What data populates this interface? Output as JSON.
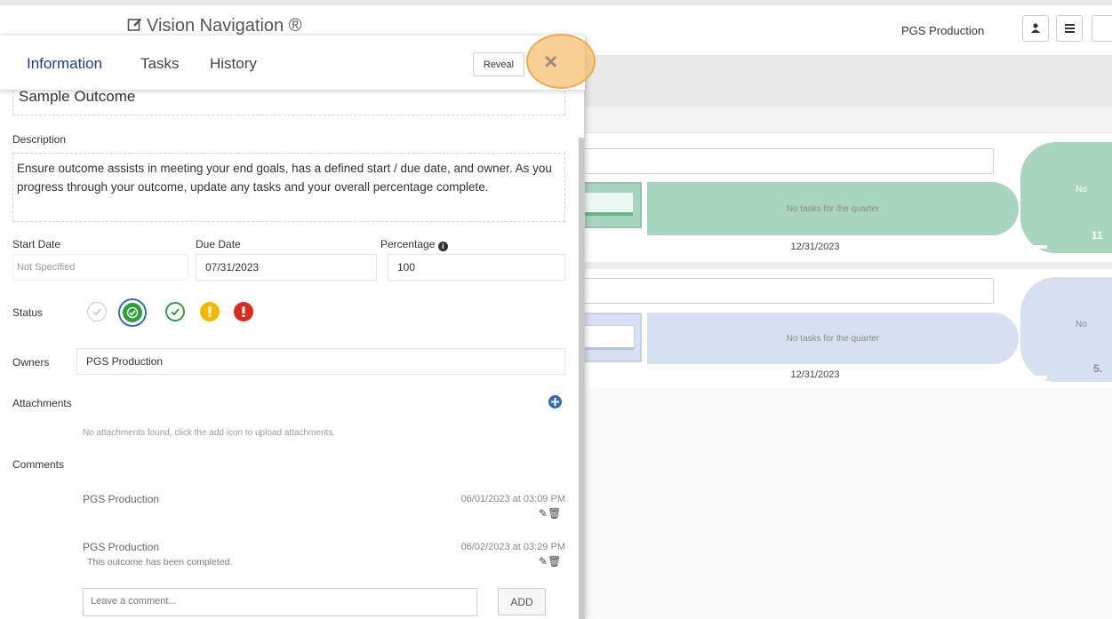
{
  "header": {
    "app_title": "Vision Navigation ®",
    "user_name": "PGS Production",
    "user_icon": "user-icon",
    "menu_icon": "hamburger-icon"
  },
  "board": {
    "rows": [
      {
        "pill_text": "No tasks for the quarter",
        "date": "12/31/2023",
        "right_text": "No",
        "right_value": "11",
        "color": "#a8d5bf"
      },
      {
        "pill_text": "No tasks for the quarter",
        "date": "12/31/2023",
        "right_text": "No",
        "right_value": "5.",
        "color": "#d6e0f0"
      }
    ]
  },
  "panel": {
    "tabs": [
      "Information",
      "Tasks",
      "History"
    ],
    "active_tab": "Information",
    "reveal_label": "Reveal",
    "close_label": "×",
    "outcome_title": "Sample Outcome",
    "description": {
      "label": "Description",
      "text": "Ensure outcome assists in meeting your end goals, has a defined start / due date, and owner. As you progress through your outcome, update any tasks and your overall percentage complete."
    },
    "dates": {
      "start_label": "Start Date",
      "start_value": "Not Specified",
      "due_label": "Due Date",
      "due_value": "07/31/2023",
      "percentage_label": "Percentage",
      "percentage_value": "100"
    },
    "status": {
      "label": "Status",
      "options": [
        "not-started",
        "completed",
        "on-track",
        "at-risk",
        "off-track"
      ],
      "selected": "completed"
    },
    "owners": {
      "label": "Owners",
      "value": "PGS Production"
    },
    "attachments": {
      "label": "Attachments",
      "empty_text": "No attachments found, click the add icon to upload attachments."
    },
    "comments": {
      "label": "Comments",
      "items": [
        {
          "author": "PGS Production",
          "timestamp": "06/01/2023 at 03:09 PM",
          "text": ""
        },
        {
          "author": "PGS Production",
          "timestamp": "06/02/2023 at 03:29 PM",
          "text": "This outcome has been completed."
        }
      ],
      "input_placeholder": "Leave a comment...",
      "add_label": "ADD"
    },
    "colors": {
      "accent": "#1d3e8f",
      "status_green": "#2e9e3a",
      "status_yellow": "#f2b800",
      "status_red": "#d92b1f",
      "add_blue": "#2f6cb3"
    }
  }
}
